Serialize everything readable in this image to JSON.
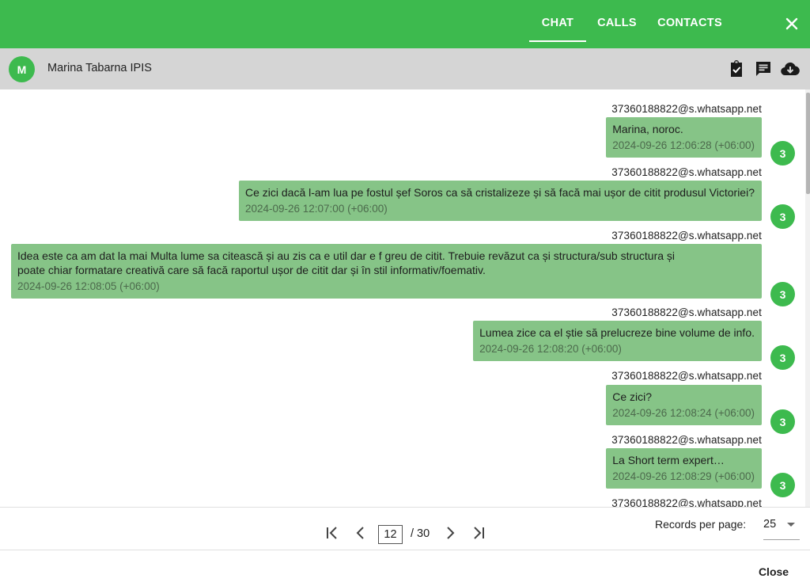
{
  "topbar": {
    "tabs": [
      "CHAT",
      "CALLS",
      "CONTACTS"
    ],
    "active_tab": "CHAT",
    "close_icon": "close-icon"
  },
  "contact": {
    "avatar_letter": "M",
    "name": "Marina Tabarna IPIS",
    "icons": [
      "clipboard-check-icon",
      "message-icon",
      "cloud-download-icon"
    ]
  },
  "messages": [
    {
      "sender": "37360188822@s.whatsapp.net",
      "text": "Marina, noroc.",
      "time": "2024-09-26 12:06:28 (+06:00)",
      "badge": "3"
    },
    {
      "sender": "37360188822@s.whatsapp.net",
      "text": "Ce zici dacă l-am lua pe fostul șef Soros ca să cristalizeze și să facă mai ușor de citit produsul Victoriei?",
      "time": "2024-09-26 12:07:00 (+06:00)",
      "badge": "3"
    },
    {
      "sender": "37360188822@s.whatsapp.net",
      "text": "Idea este ca am dat la mai Multa lume sa citească și au zis ca e util dar e f greu de citit. Trebuie revăzut ca și structura/sub structura și\npoate chiar formatare creativă care să facă raportul ușor de citit dar și în stil informativ/foemativ.",
      "time": "2024-09-26 12:08:05 (+06:00)",
      "badge": "3"
    },
    {
      "sender": "37360188822@s.whatsapp.net",
      "text": "Lumea zice ca el știe să prelucreze bine volume de info.",
      "time": "2024-09-26 12:08:20 (+06:00)",
      "badge": "3"
    },
    {
      "sender": "37360188822@s.whatsapp.net",
      "text": "Ce zici?",
      "time": "2024-09-26 12:08:24 (+06:00)",
      "badge": "3"
    },
    {
      "sender": "37360188822@s.whatsapp.net",
      "text": "La Short term expert…",
      "time": "2024-09-26 12:08:29 (+06:00)",
      "badge": "3"
    },
    {
      "sender": "37360188822@s.whatsapp.net",
      "text": "",
      "time": "",
      "badge": ""
    }
  ],
  "pagination": {
    "current_page": "12",
    "total_pages": "/ 30",
    "records_label": "Records per page:",
    "records_value": "25"
  },
  "footer": {
    "close_label": "Close"
  },
  "colors": {
    "brand_green": "#3dba4e",
    "bubble_green": "#86c487",
    "header_gray": "#d5d5d5"
  }
}
